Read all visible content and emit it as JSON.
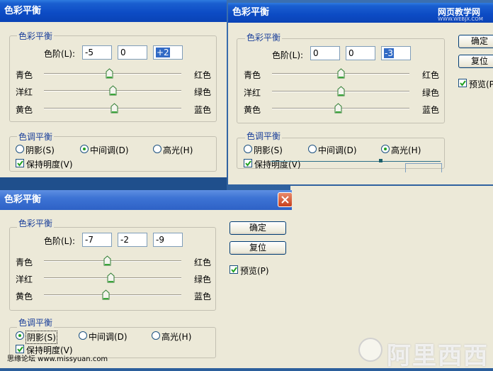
{
  "colors": {
    "desktop": "#2b5e9b",
    "dialog": "#ece9d8",
    "legend": "#1a3f9a",
    "titlebar": "#0c4bc4"
  },
  "watermark_top": {
    "site": "网页教学网",
    "url": "WWW.WEBJX.COM"
  },
  "watermark_bottom": {
    "left": "思缘论坛 www.missyuan.com",
    "logo": "阿里西西"
  },
  "dialogs": [
    {
      "title": "色彩平衡",
      "group_balance": "色彩平衡",
      "levels_label": "色阶(L):",
      "levels": [
        "-5",
        "0",
        "+2"
      ],
      "sliders": [
        {
          "left": "青色",
          "right": "红色",
          "value": -5
        },
        {
          "left": "洋红",
          "right": "绿色",
          "value": 0
        },
        {
          "left": "黄色",
          "right": "蓝色",
          "value": 2
        }
      ],
      "group_tone": "色调平衡",
      "tones": [
        "阴影(S)",
        "中间调(D)",
        "高光(H)"
      ],
      "tone_selected": 1,
      "preserve": "保持明度(V)"
    },
    {
      "title": "色彩平衡",
      "group_balance": "色彩平衡",
      "levels_label": "色阶(L):",
      "levels": [
        "0",
        "0",
        "-3"
      ],
      "sliders": [
        {
          "left": "青色",
          "right": "红色",
          "value": 0
        },
        {
          "left": "洋红",
          "right": "绿色",
          "value": 0
        },
        {
          "left": "黄色",
          "right": "蓝色",
          "value": -3
        }
      ],
      "group_tone": "色调平衡",
      "tones": [
        "阴影(S)",
        "中间调(D)",
        "高光(H)"
      ],
      "tone_selected": 2,
      "preserve": "保持明度(V)",
      "ok": "确定",
      "reset": "复位",
      "preview": "预览(P)"
    },
    {
      "title": "色彩平衡",
      "group_balance": "色彩平衡",
      "levels_label": "色阶(L):",
      "levels": [
        "-7",
        "-2",
        "-9"
      ],
      "sliders": [
        {
          "left": "青色",
          "right": "红色",
          "value": -7
        },
        {
          "left": "洋红",
          "right": "绿色",
          "value": -2
        },
        {
          "left": "黄色",
          "right": "蓝色",
          "value": -9
        }
      ],
      "group_tone": "色调平衡",
      "tones": [
        "阴影(S)",
        "中间调(D)",
        "高光(H)"
      ],
      "tone_selected": 0,
      "preserve": "保持明度(V)",
      "ok": "确定",
      "reset": "复位",
      "preview": "预览(P)"
    }
  ]
}
